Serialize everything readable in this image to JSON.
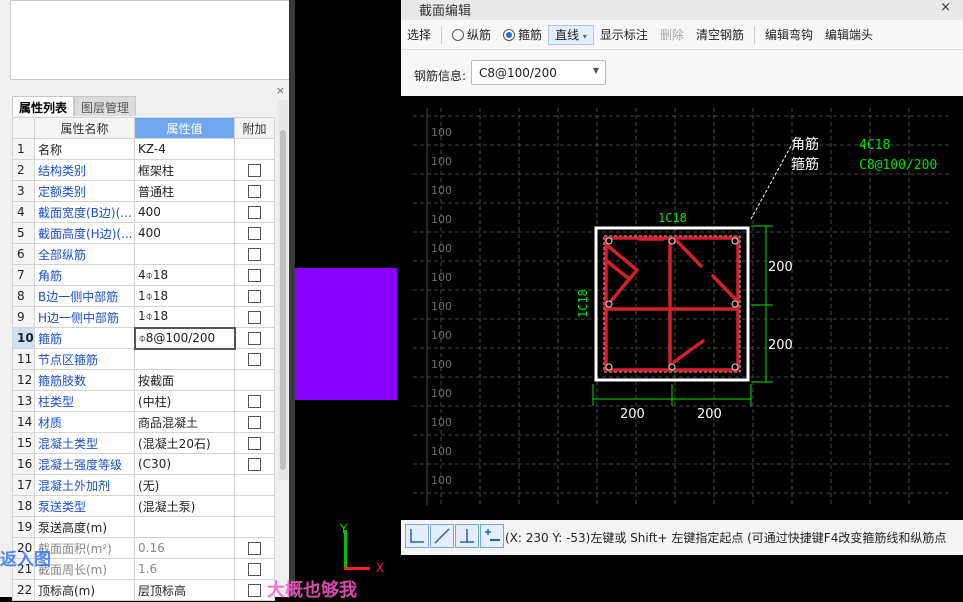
{
  "left_panel": {
    "close_glyph": "×",
    "tabs": [
      {
        "label": "属性列表"
      },
      {
        "label": "图层管理"
      }
    ],
    "columns": [
      "",
      "属性名称",
      "属性值",
      "附加"
    ],
    "rows": [
      {
        "num": "1",
        "name": "名称",
        "value": "KZ-4",
        "check": false
      },
      {
        "num": "2",
        "name": "结构类别",
        "value": "框架柱",
        "check": true
      },
      {
        "num": "3",
        "name": "定额类别",
        "value": "普通柱",
        "check": true
      },
      {
        "num": "4",
        "name": "截面宽度(B边)(...",
        "value": "400",
        "check": true
      },
      {
        "num": "5",
        "name": "截面高度(H边)(...",
        "value": "400",
        "check": true
      },
      {
        "num": "6",
        "name": "全部纵筋",
        "value": "",
        "check": true
      },
      {
        "num": "7",
        "name": "角筋",
        "value": "4⌽18",
        "check": true
      },
      {
        "num": "8",
        "name": "B边一侧中部筋",
        "value": "1⌽18",
        "check": true
      },
      {
        "num": "9",
        "name": "H边一侧中部筋",
        "value": "1⌽18",
        "check": true
      },
      {
        "num": "10",
        "name": "箍筋",
        "value": "⌽8@100/200",
        "check": true
      },
      {
        "num": "11",
        "name": "节点区箍筋",
        "value": "",
        "check": true
      },
      {
        "num": "12",
        "name": "箍筋肢数",
        "value": "按截面",
        "check": false
      },
      {
        "num": "13",
        "name": "柱类型",
        "value": "(中柱)",
        "check": true
      },
      {
        "num": "14",
        "name": "材质",
        "value": "商品混凝土",
        "check": true
      },
      {
        "num": "15",
        "name": "混凝土类型",
        "value": "(混凝土20石)",
        "check": true
      },
      {
        "num": "16",
        "name": "混凝土强度等级",
        "value": "(C30)",
        "check": true
      },
      {
        "num": "17",
        "name": "混凝土外加剂",
        "value": "(无)",
        "check": false
      },
      {
        "num": "18",
        "name": "泵送类型",
        "value": "(混凝土泵)",
        "check": false
      },
      {
        "num": "19",
        "name": "泵送高度(m)",
        "value": "",
        "check": false
      },
      {
        "num": "20",
        "name": "截面面积(m²)",
        "value": "0.16",
        "check": true
      },
      {
        "num": "21",
        "name": "截面周长(m)",
        "value": "1.6",
        "check": true
      },
      {
        "num": "22",
        "name": "顶标高(m)",
        "value": "层顶标高",
        "check": true
      }
    ]
  },
  "axis": {
    "y": "Y",
    "x": "X"
  },
  "overlays": {
    "left": "返入图",
    "bottom": "大概也够我"
  },
  "dialog": {
    "title": "截面编辑",
    "close_glyph": "×",
    "toolbar": {
      "select": "选择",
      "radio_longitudinal": "纵筋",
      "radio_stirrup": "箍筋",
      "line_combo": "直线",
      "show_labels": "显示标注",
      "delete": "删除",
      "clear": "清空钢筋",
      "edit_hook": "编辑弯钩",
      "edit_end": "编辑端头"
    },
    "rebar_info_label": "钢筋信息:",
    "rebar_info_value": "C8@100/200",
    "canvas": {
      "grid_label": "100",
      "corner_label": "角筋",
      "stirrup_label": "箍筋",
      "corner_value": "4C18",
      "stirrup_value": "C8@100/200",
      "top_label": "1C18",
      "left_label": "1C18",
      "dim_right_top": "200",
      "dim_right_bottom": "200",
      "dim_bottom_left": "200",
      "dim_bottom_right": "200"
    },
    "status_text": "(X: 230 Y: -53)左键或 Shift+ 左键指定起点 (可通过快捷键F4改变箍筋线和纵筋点"
  },
  "colors": {
    "accent_blue": "#6fa8ee",
    "link_blue": "#1a4fd0",
    "stirrup_red": "#d2202c",
    "label_green": "#00e000",
    "purple_block": "#8a00ff"
  }
}
